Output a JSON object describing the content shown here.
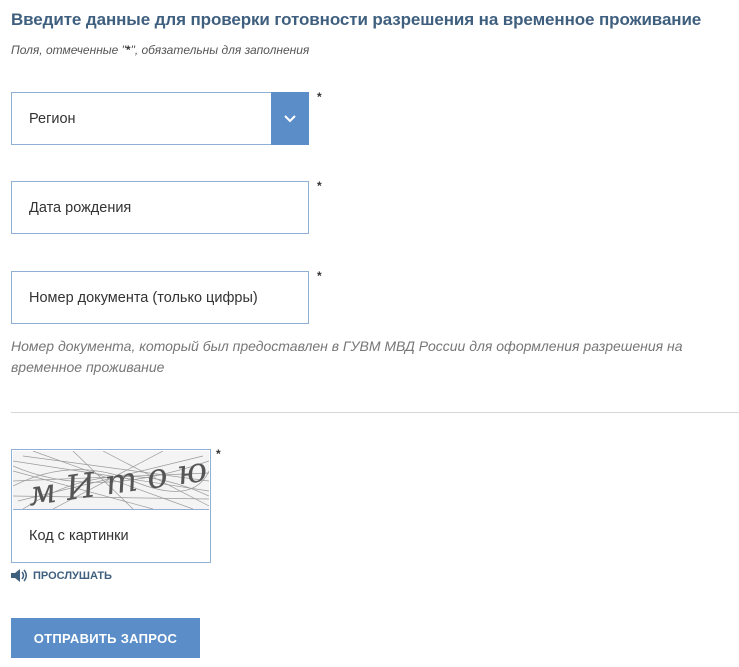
{
  "form": {
    "title": "Введите данные для проверки готовности разрешения на временное проживание",
    "required_note_prefix": "Поля, отмеченные \"",
    "required_note_star": "*",
    "required_note_suffix": "\", обязательны для заполнения",
    "required_star": "*",
    "fields": {
      "region": {
        "placeholder": "Регион"
      },
      "birth_date": {
        "placeholder": "Дата рождения"
      },
      "document_number": {
        "placeholder": "Номер документа (только цифры)",
        "hint": "Номер документа, который был предоставлен в ГУВМ МВД России для оформления разрешения на временное проживание"
      }
    },
    "captcha": {
      "image_text": "мИтою",
      "placeholder": "Код с картинки",
      "listen_label": "ПРОСЛУШАТЬ"
    },
    "submit_label": "ОТПРАВИТЬ ЗАПРОС"
  },
  "icons": {
    "select_arrow": "chevron-down-icon",
    "listen": "speaker-icon"
  },
  "colors": {
    "accent": "#5b8ec8",
    "title": "#3f5f7f",
    "border": "#8fb0d4"
  }
}
